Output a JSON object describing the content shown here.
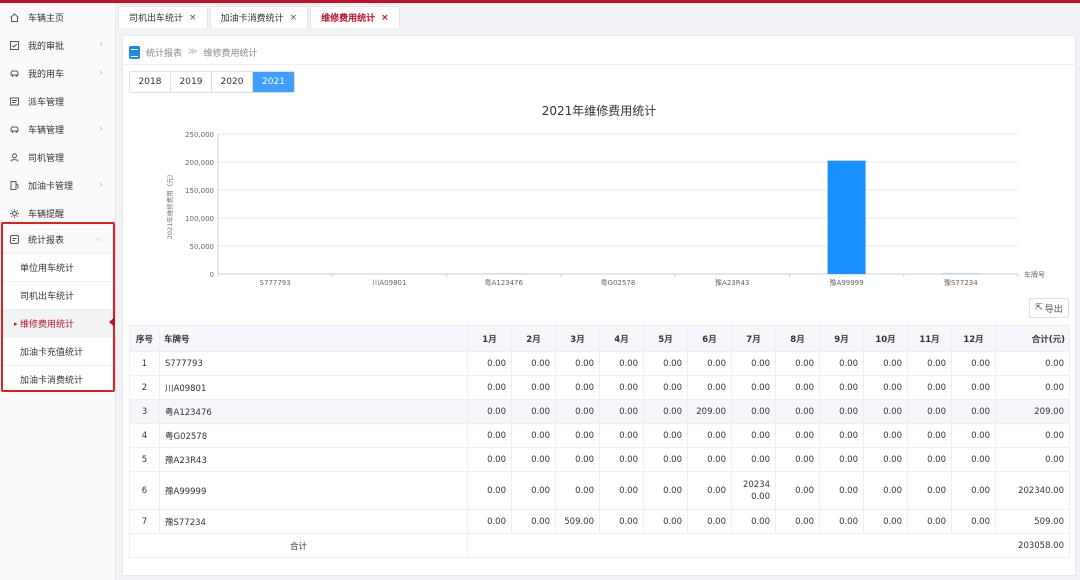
{
  "sidebar": {
    "items": [
      {
        "label": "车辆主页",
        "icon": "home-icon",
        "chev": false
      },
      {
        "label": "我的审批",
        "icon": "checkbox-icon",
        "chev": true
      },
      {
        "label": "我的用车",
        "icon": "car-icon",
        "chev": true
      },
      {
        "label": "派车管理",
        "icon": "dispatch-icon",
        "chev": false
      },
      {
        "label": "车辆管理",
        "icon": "car-icon",
        "chev": true
      },
      {
        "label": "司机管理",
        "icon": "person-icon",
        "chev": false
      },
      {
        "label": "加油卡管理",
        "icon": "fuel-icon",
        "chev": true
      },
      {
        "label": "车辆提醒",
        "icon": "gear-icon",
        "chev": false
      }
    ],
    "stats_menu": {
      "label": "统计报表",
      "sub_items": [
        {
          "label": "单位用车统计",
          "active": false
        },
        {
          "label": "司机出车统计",
          "active": false
        },
        {
          "label": "维修费用统计",
          "active": true
        },
        {
          "label": "加油卡充值统计",
          "active": false
        },
        {
          "label": "加油卡消费统计",
          "active": false
        }
      ]
    }
  },
  "tabs": [
    {
      "label": "司机出车统计",
      "close": "×"
    },
    {
      "label": "加油卡消费统计",
      "close": "×"
    },
    {
      "label": "维修费用统计",
      "close": "×"
    }
  ],
  "breadcrumb": {
    "parent": "统计报表",
    "sep": "≫",
    "current": "维修费用统计"
  },
  "years": [
    "2018",
    "2019",
    "2020",
    "2021"
  ],
  "selected_year": "2021",
  "export_label": "导出",
  "colors": {
    "accent": "#c0102a",
    "bar": "#1890ff",
    "year_active": "#409eff"
  },
  "chart_data": {
    "type": "bar",
    "title": "2021年维修费用统计",
    "xlabel": "车牌号",
    "ylabel": "2021年维修费用（元）",
    "categories": [
      "S777793",
      "川A09801",
      "粤A123476",
      "粤G02578",
      "豫A23R43",
      "豫A99999",
      "豫S77234"
    ],
    "values": [
      0,
      0,
      209,
      0,
      0,
      202340,
      509
    ],
    "ylim": [
      0,
      250000
    ],
    "yticks": [
      "0",
      "50,000",
      "100,000",
      "150,000",
      "200,000",
      "250,000"
    ],
    "ytick_values": [
      0,
      50000,
      100000,
      150000,
      200000,
      250000
    ],
    "grid": true
  },
  "table": {
    "headers": [
      "序号",
      "车牌号",
      "1月",
      "2月",
      "3月",
      "4月",
      "5月",
      "6月",
      "7月",
      "8月",
      "9月",
      "10月",
      "11月",
      "12月",
      "合计(元)"
    ],
    "rows": [
      [
        "1",
        "S777793",
        "0.00",
        "0.00",
        "0.00",
        "0.00",
        "0.00",
        "0.00",
        "0.00",
        "0.00",
        "0.00",
        "0.00",
        "0.00",
        "0.00",
        "0.00"
      ],
      [
        "2",
        "川A09801",
        "0.00",
        "0.00",
        "0.00",
        "0.00",
        "0.00",
        "0.00",
        "0.00",
        "0.00",
        "0.00",
        "0.00",
        "0.00",
        "0.00",
        "0.00"
      ],
      [
        "3",
        "粤A123476",
        "0.00",
        "0.00",
        "0.00",
        "0.00",
        "0.00",
        "209.00",
        "0.00",
        "0.00",
        "0.00",
        "0.00",
        "0.00",
        "0.00",
        "209.00"
      ],
      [
        "4",
        "粤G02578",
        "0.00",
        "0.00",
        "0.00",
        "0.00",
        "0.00",
        "0.00",
        "0.00",
        "0.00",
        "0.00",
        "0.00",
        "0.00",
        "0.00",
        "0.00"
      ],
      [
        "5",
        "豫A23R43",
        "0.00",
        "0.00",
        "0.00",
        "0.00",
        "0.00",
        "0.00",
        "0.00",
        "0.00",
        "0.00",
        "0.00",
        "0.00",
        "0.00",
        "0.00"
      ],
      [
        "6",
        "豫A99999",
        "0.00",
        "0.00",
        "0.00",
        "0.00",
        "0.00",
        "0.00",
        "202340.00",
        "0.00",
        "0.00",
        "0.00",
        "0.00",
        "0.00",
        "202340.00"
      ],
      [
        "7",
        "豫S77234",
        "0.00",
        "0.00",
        "509.00",
        "0.00",
        "0.00",
        "0.00",
        "0.00",
        "0.00",
        "0.00",
        "0.00",
        "0.00",
        "0.00",
        "509.00"
      ]
    ],
    "total_label": "合计",
    "total_value": "203058.00"
  }
}
